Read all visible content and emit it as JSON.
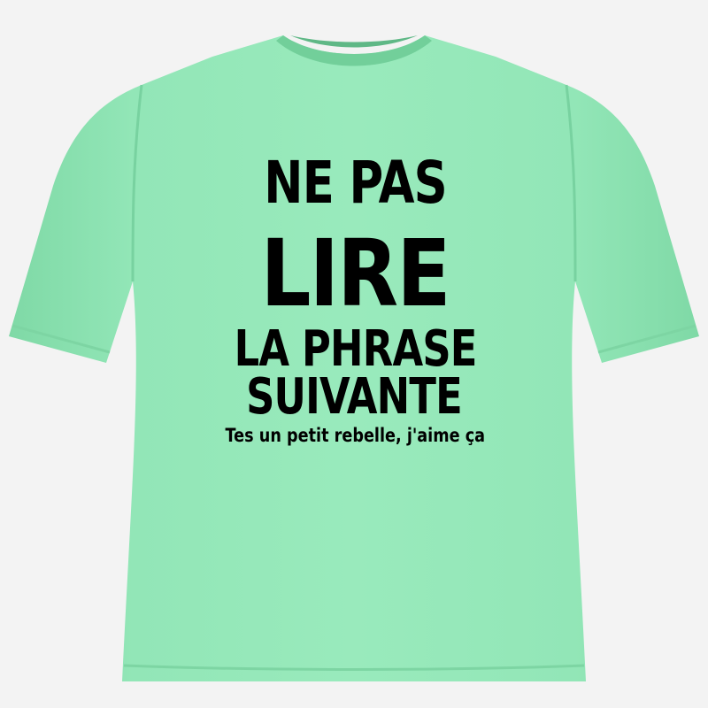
{
  "shirt": {
    "color": "#8fe3b3",
    "shadow_color": "#6fcf98",
    "background_color": "#f3f3f3",
    "print_color": "#000000"
  },
  "print": {
    "line1": "NE PAS",
    "line2": "LIRE",
    "line3": "LA PHRASE",
    "line4": "SUIVANTE",
    "line5": "Tes un petit rebelle, j'aime ça"
  }
}
